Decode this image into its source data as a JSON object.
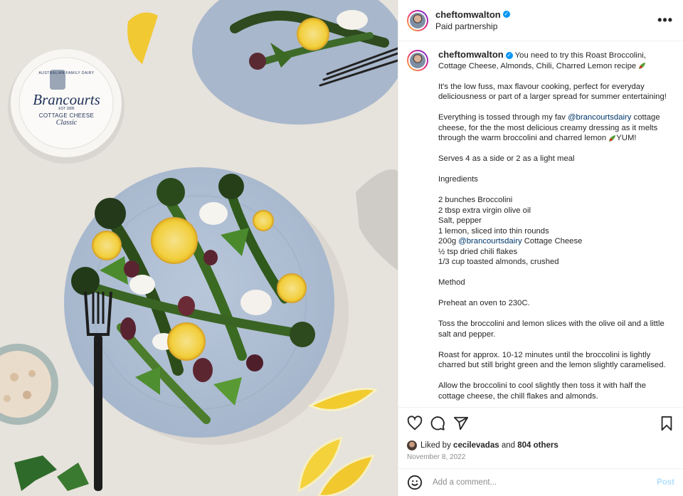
{
  "header": {
    "username": "cheftomwalton",
    "subtitle": "Paid partnership",
    "more_label": "•••"
  },
  "photo": {
    "jar_brand": "Brancourts",
    "jar_top_text": "AUSTRALIAN FAMILY DAIRY",
    "jar_est": "EST 1895",
    "jar_product": "COTTAGE CHEESE",
    "jar_variant": "Classic"
  },
  "caption": {
    "username": "cheftomwalton",
    "intro": "You need to try this Roast Broccolini, Cottage Cheese, Almonds, Chili, Charred Lemon recipe",
    "para1": "It's the low fuss, max flavour cooking, perfect for everyday deliciousness or part of a larger spread for summer entertaining!",
    "para2_a": "Everything is tossed through my fav",
    "mention": "@brancourtsdairy",
    "para2_b": "cottage cheese, for the the most delicious creamy dressing as it melts through the warm broccolini and charred lemon",
    "para2_c": "YUM!",
    "serves": "Serves 4 as a side or 2 as a light meal",
    "ingredients_heading": "Ingredients",
    "ingredients": [
      "2 bunches Broccolini",
      "2 tbsp extra virgin olive oil",
      "Salt, pepper",
      "1 lemon, sliced into thin rounds"
    ],
    "ingredient_cheese_qty": "200g",
    "ingredient_cheese_mention": "@brancourtsdairy",
    "ingredient_cheese_name": "Cottage Cheese",
    "ingredients_2": [
      "½ tsp dried chili flakes",
      "1/3 cup toasted almonds, crushed"
    ],
    "method_heading": "Method",
    "steps": [
      "Preheat an oven to 230C.",
      "Toss the broccolini and lemon slices with the olive oil and a little salt and pepper.",
      "Roast for approx. 10-12 minutes until the broccolini is lightly charred but still bright green and the lemon slightly caramelised.",
      "Allow the broccolini to cool slightly then toss it with half the cottage cheese, the chill flakes and almonds."
    ]
  },
  "actions": {
    "liked_prefix": "Liked by",
    "liked_user": "cecilevadas",
    "liked_and": "and",
    "liked_count": "804 others",
    "date": "November 8, 2022"
  },
  "comment": {
    "placeholder": "Add a comment...",
    "post_label": "Post"
  },
  "colors": {
    "accent": "#0095f6",
    "mention": "#00376b",
    "post_disabled": "#b2dffc"
  },
  "icons": [
    "more-icon",
    "heart-icon",
    "comment-icon",
    "share-icon",
    "bookmark-icon",
    "emoji-icon",
    "verified-icon",
    "leaf-icon"
  ]
}
